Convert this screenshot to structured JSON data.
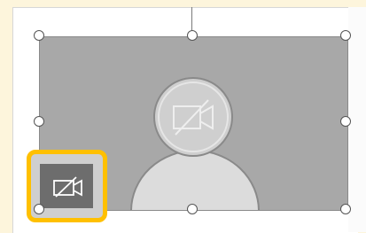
{
  "canvas": {
    "background_color": "#fdf5dc",
    "slide_color": "#ffffff"
  },
  "video_placeholder": {
    "placeholder_color": "#a8a8a8",
    "avatar_color": "#dcdcdc",
    "camera_icon": "camera-off-icon"
  },
  "selection": {
    "handle_color": "#555555",
    "handles": [
      "top-left",
      "top-center",
      "top-right",
      "middle-left",
      "middle-right",
      "bottom-left",
      "bottom-center",
      "bottom-right"
    ]
  },
  "camera_toggle": {
    "icon": "camera-off-icon",
    "highlight_color": "#ffc000",
    "button_color": "#6d6d6d"
  }
}
